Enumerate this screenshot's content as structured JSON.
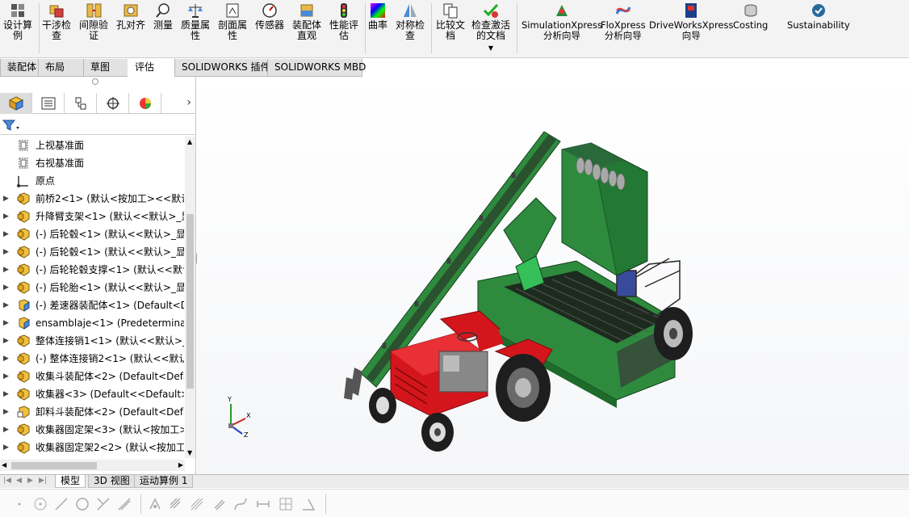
{
  "ribbon": {
    "buttons": [
      {
        "label": "设计算\n例",
        "icon": "design-table-icon"
      },
      {
        "label": "干涉检\n查",
        "icon": "interference-check-icon"
      },
      {
        "label": "间隙验\n证",
        "icon": "clearance-verify-icon"
      },
      {
        "label": "孔对齐",
        "icon": "hole-alignment-icon"
      },
      {
        "label": "测量",
        "icon": "measure-icon"
      },
      {
        "label": "质量属\n性",
        "icon": "mass-properties-icon"
      },
      {
        "label": "剖面属\n性",
        "icon": "section-properties-icon"
      },
      {
        "label": "传感器",
        "icon": "sensor-icon"
      },
      {
        "label": "装配体\n直观",
        "icon": "assembly-visualization-icon"
      },
      {
        "label": "性能评\n估",
        "icon": "performance-evaluation-icon"
      },
      {
        "label": "曲率",
        "icon": "curvature-icon"
      },
      {
        "label": "对称检\n查",
        "icon": "symmetry-check-icon"
      },
      {
        "label": "比较文\n档",
        "icon": "compare-documents-icon"
      },
      {
        "label": "检查激活\n的文档",
        "icon": "check-active-document-icon"
      },
      {
        "label": "SimulationXpress\n分析向导",
        "icon": "simulationxpress-icon"
      },
      {
        "label": "FloXpress\n分析向导",
        "icon": "floxpress-icon"
      },
      {
        "label": "DriveWorksXpress\n向导",
        "icon": "driveworksxpress-icon"
      },
      {
        "label": "Costing",
        "icon": "costing-icon"
      },
      {
        "label": "Sustainability",
        "icon": "sustainability-icon"
      }
    ]
  },
  "command_tabs": [
    "装配体",
    "布局",
    "草图",
    "评估",
    "SOLIDWORKS 插件",
    "SOLIDWORKS MBD"
  ],
  "active_command_tab": "评估",
  "tree": [
    {
      "label": "上视基准面",
      "type": "plane",
      "expandable": false
    },
    {
      "label": "右视基准面",
      "type": "plane",
      "expandable": false
    },
    {
      "label": "原点",
      "type": "origin",
      "expandable": false
    },
    {
      "label": "前桥2<1> (默认<按加工><<默认",
      "type": "assembly",
      "expandable": true
    },
    {
      "label": "升降臂支架<1> (默认<<默认>_显",
      "type": "assembly",
      "expandable": true
    },
    {
      "label": "(-) 后轮毂<1> (默认<<默认>_显示",
      "type": "assembly",
      "expandable": true
    },
    {
      "label": "(-) 后轮毂<1> (默认<<默认>_显",
      "type": "assembly",
      "expandable": true
    },
    {
      "label": "(-) 后轮轮毂支撑<1> (默认<<默认",
      "type": "assembly",
      "expandable": true
    },
    {
      "label": "(-) 后轮胎<1> (默认<<默认>_显示",
      "type": "assembly",
      "expandable": true
    },
    {
      "label": "(-) 差速器装配体<1> (Default<D",
      "type": "part",
      "expandable": true
    },
    {
      "label": "ensamblaje<1> (Predeterminac",
      "type": "part",
      "expandable": true
    },
    {
      "label": "整体连接销1<1> (默认<<默认>_显",
      "type": "assembly",
      "expandable": true
    },
    {
      "label": "(-) 整体连接销2<1> (默认<<默认",
      "type": "assembly",
      "expandable": true
    },
    {
      "label": "收集斗装配体<2> (Default<Defa",
      "type": "assembly",
      "expandable": true
    },
    {
      "label": "收集器<3> (Default<<Default>_",
      "type": "assembly",
      "expandable": true
    },
    {
      "label": "卸料斗装配体<2> (Default<Defa",
      "type": "assembly-alt",
      "expandable": true
    },
    {
      "label": "收集器固定架<3> (默认<按加工>",
      "type": "assembly",
      "expandable": true
    },
    {
      "label": "收集器固定架2<2> (默认<按加工",
      "type": "assembly",
      "expandable": true
    }
  ],
  "bottom_tabs": [
    "模型",
    "3D 视图",
    "运动算例 1"
  ],
  "active_bottom_tab": "模型",
  "triad": {
    "x": "X",
    "y": "Y",
    "z": "Z"
  },
  "colors": {
    "frame_green": "#2e8b3e",
    "tractor_red": "#d4161c",
    "chain_dark": "#2a3a2a",
    "tire_dark": "#1e1e1e"
  }
}
